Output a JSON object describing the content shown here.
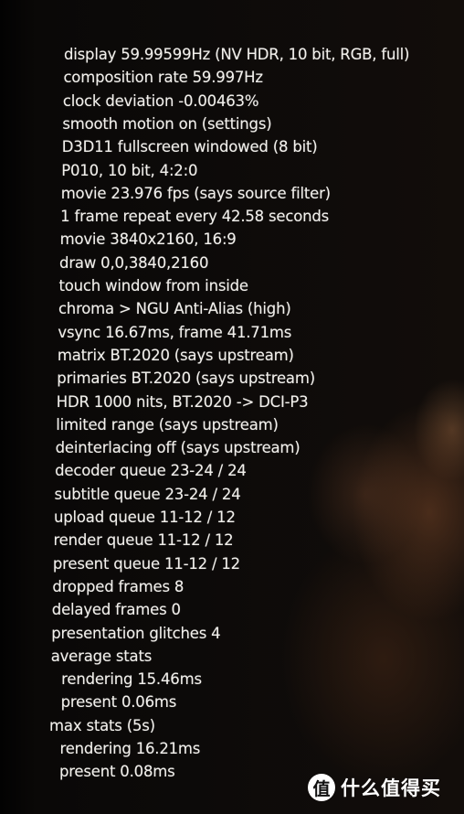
{
  "osd": {
    "lines": [
      {
        "text": "display 59.99599Hz  (NV HDR, 10 bit, RGB, full)",
        "indent": 0
      },
      {
        "text": "composition rate 59.997Hz",
        "indent": 0
      },
      {
        "text": "clock deviation -0.00463%",
        "indent": 0
      },
      {
        "text": "smooth motion on (settings)",
        "indent": 0
      },
      {
        "text": "D3D11 fullscreen windowed (8 bit)",
        "indent": 0
      },
      {
        "text": "P010, 10 bit, 4:2:0",
        "indent": 0
      },
      {
        "text": "movie 23.976 fps  (says source filter)",
        "indent": 0
      },
      {
        "text": "1 frame repeat every 42.58 seconds",
        "indent": 0
      },
      {
        "text": "movie 3840x2160, 16:9",
        "indent": 0
      },
      {
        "text": "draw 0,0,3840,2160",
        "indent": 0
      },
      {
        "text": "touch window from inside",
        "indent": 0
      },
      {
        "text": "chroma > NGU Anti-Alias (high)",
        "indent": 0
      },
      {
        "text": "vsync 16.67ms, frame 41.71ms",
        "indent": 0
      },
      {
        "text": "matrix BT.2020 (says upstream)",
        "indent": 0
      },
      {
        "text": "primaries BT.2020 (says upstream)",
        "indent": 0
      },
      {
        "text": "HDR 1000 nits, BT.2020 -> DCI-P3",
        "indent": 0
      },
      {
        "text": "limited range (says upstream)",
        "indent": 0
      },
      {
        "text": "deinterlacing off (says upstream)",
        "indent": 0
      },
      {
        "text": "decoder queue 23-24 / 24",
        "indent": 0
      },
      {
        "text": "subtitle queue 23-24 / 24",
        "indent": 0
      },
      {
        "text": "upload queue 11-12 / 12",
        "indent": 0
      },
      {
        "text": "render queue 11-12 / 12",
        "indent": 0
      },
      {
        "text": "present queue 11-12 / 12",
        "indent": 0
      },
      {
        "text": "dropped frames 8",
        "indent": 0
      },
      {
        "text": "delayed frames 0",
        "indent": 0
      },
      {
        "text": "presentation glitches 4",
        "indent": 0
      },
      {
        "text": "average stats",
        "indent": 0
      },
      {
        "text": "rendering 15.46ms",
        "indent": 1
      },
      {
        "text": "present 0.06ms",
        "indent": 1
      },
      {
        "text": "max stats (5s)",
        "indent": 0
      },
      {
        "text": "rendering 16.21ms",
        "indent": 1
      },
      {
        "text": "present 0.08ms",
        "indent": 1
      }
    ]
  },
  "watermark": {
    "logo": "值",
    "text": "什么值得买"
  }
}
